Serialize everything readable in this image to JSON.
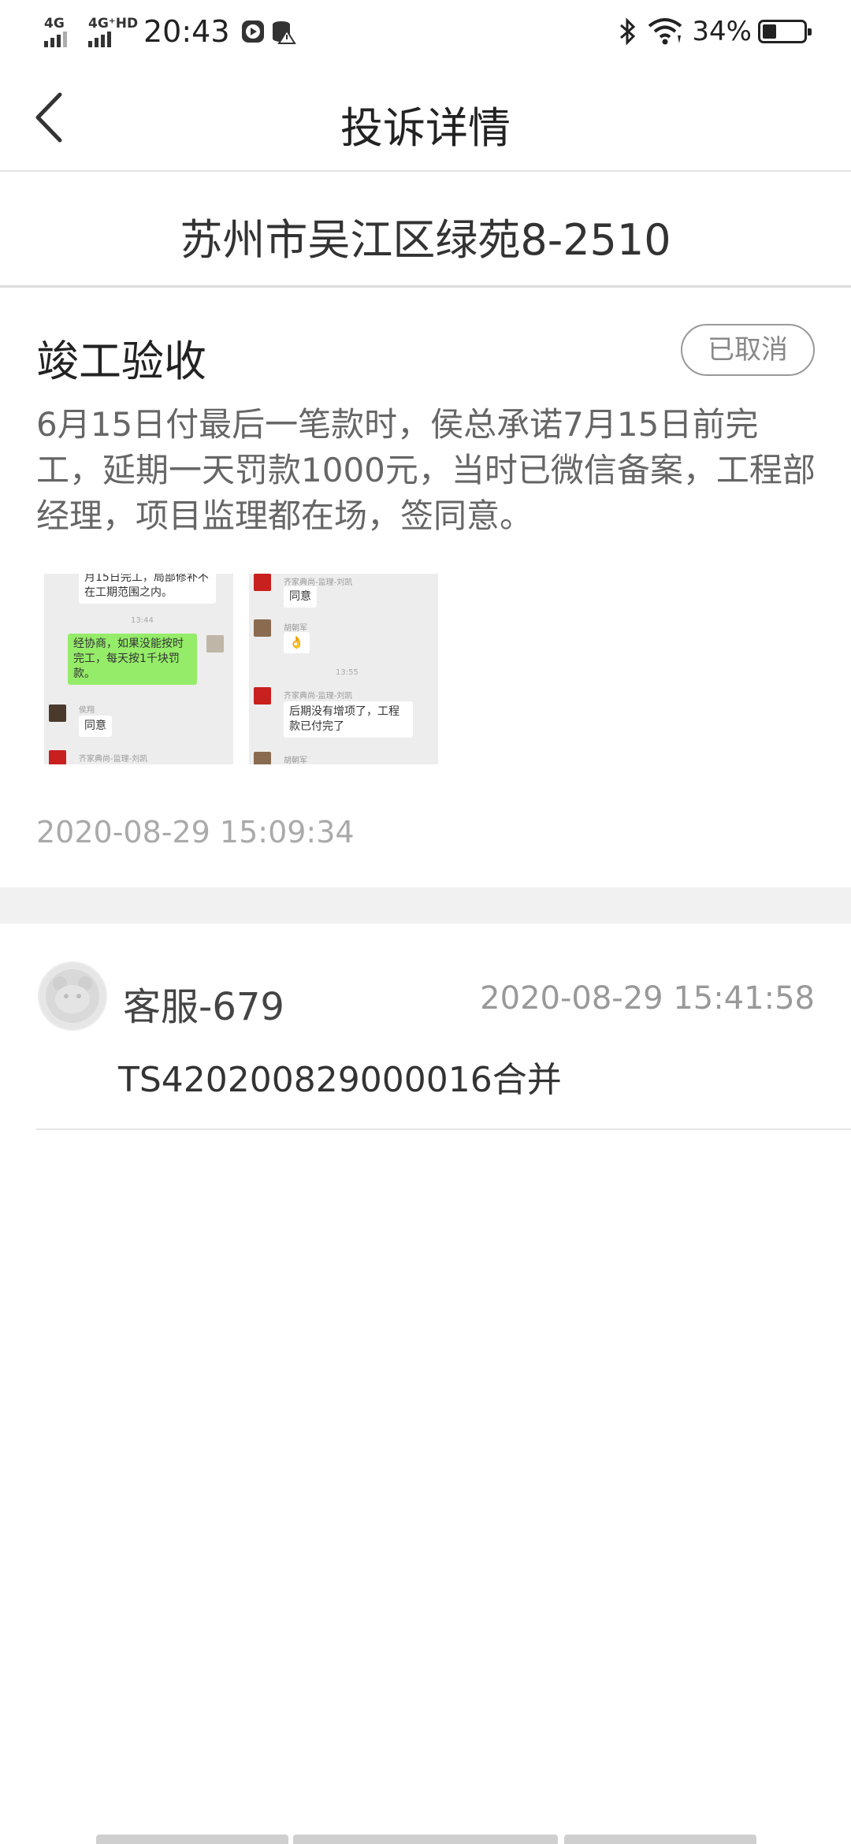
{
  "status_bar": {
    "network1": "4G",
    "network2": "4G⁺HD",
    "time": "20:43",
    "battery_percent": "34%",
    "battery_level": 0.34
  },
  "nav": {
    "title": "投诉详情"
  },
  "complaint": {
    "address": "苏州市吴江区绿苑8-2510",
    "category": "竣工验收",
    "status": "已取消",
    "description": "6月15日付最后一笔款时，侯总承诺7月15日前完工，延期一天罚款1000元，当时已微信备案，工程部经理，项目监理都在场，签同意。",
    "created_at": "2020-08-29 15:09:34",
    "images": [
      {
        "chat": {
          "top_text": "月15日完工，局部修补不在工期范围之内。",
          "time": "13:44",
          "green_msg": "经协商，如果没能按时完工，每天按1千块罚款。",
          "name1": "侯翔",
          "reply1": "同意",
          "name2": "齐家典尚-监理-刘凯"
        }
      },
      {
        "chat": {
          "name1": "齐家典尚-监理-刘凯",
          "reply1": "同意",
          "name2": "胡朝军",
          "emoji": "👌",
          "time": "13:55",
          "name3": "齐家典尚-监理-刘凯",
          "reply2": "后期没有增项了，工程款已付完了",
          "name4": "胡朝军"
        }
      }
    ]
  },
  "reply": {
    "author": "客服-679",
    "time": "2020-08-29 15:41:58",
    "text": "TS420200829000016合并"
  },
  "colors": {
    "badge_border": "#999999",
    "green_bubble": "#95ec69",
    "muted_text": "#aaaaaa"
  },
  "icons": [
    "back-icon",
    "wifi-icon",
    "bluetooth-icon",
    "battery-icon"
  ]
}
